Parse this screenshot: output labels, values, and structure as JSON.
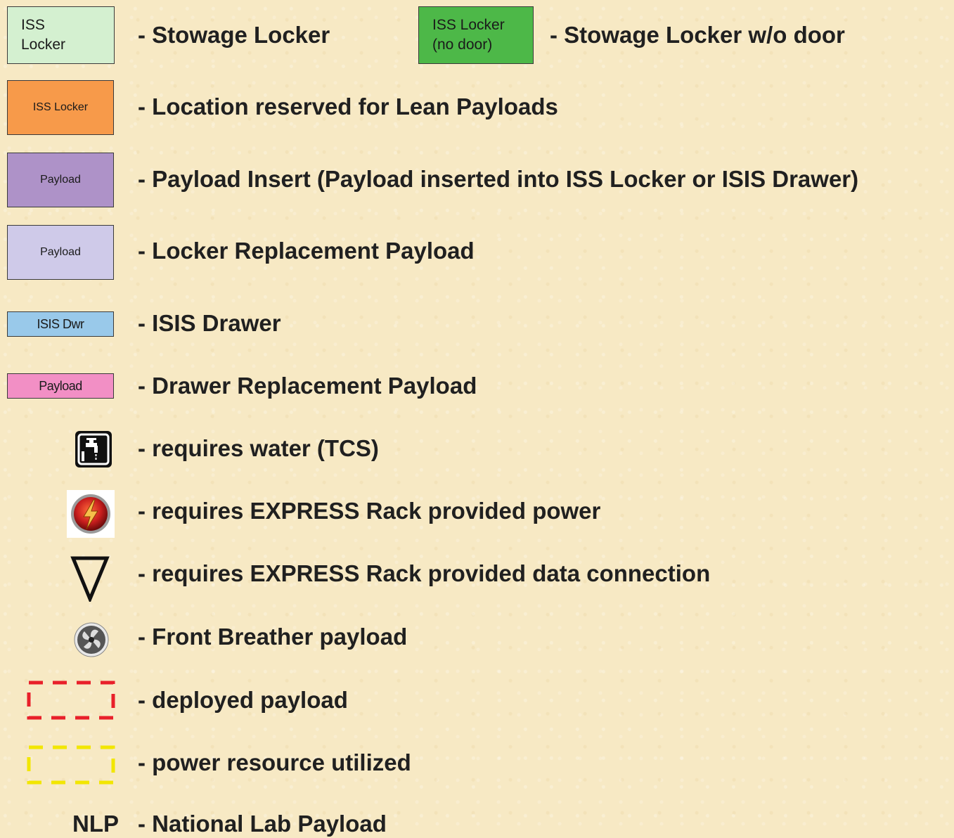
{
  "legend": {
    "stowage_locker": {
      "line1": "ISS",
      "line2": "Locker",
      "color": "#d4f0d0",
      "desc": "- Stowage Locker"
    },
    "stowage_no_door": {
      "line1": "ISS Locker",
      "line2": "(no door)",
      "color": "#4db848",
      "desc": "- Stowage Locker w/o door"
    },
    "lean_payload": {
      "label": "ISS Locker",
      "color": "#f79a4a",
      "desc": "- Location reserved for Lean Payloads"
    },
    "payload_insert": {
      "label": "Payload",
      "color": "#ae92c8",
      "desc": "- Payload Insert (Payload inserted into ISS Locker or ISIS Drawer)"
    },
    "locker_replacement": {
      "label": "Payload",
      "color": "#cfcae9",
      "desc": "- Locker Replacement Payload"
    },
    "isis_drawer": {
      "label": "ISIS Dwr",
      "color": "#99c9ea",
      "desc": "- ISIS Drawer"
    },
    "drawer_replacement": {
      "label": "Payload",
      "color": "#f28fc5",
      "desc": "- Drawer Replacement Payload"
    },
    "water": {
      "icon": "water-faucet-icon",
      "desc": "- requires water (TCS)"
    },
    "power": {
      "icon": "power-bolt-icon",
      "desc": "- requires EXPRESS Rack provided power"
    },
    "data": {
      "icon": "data-triangle-icon",
      "desc": "- requires EXPRESS Rack provided data connection"
    },
    "breather": {
      "icon": "fan-icon",
      "desc": "- Front Breather payload"
    },
    "deployed": {
      "color": "#e8202a",
      "desc": "- deployed payload"
    },
    "power_util": {
      "color": "#f2e600",
      "desc": "- power resource utilized"
    },
    "nlp": {
      "abbr": "NLP",
      "desc": "- National Lab Payload"
    }
  }
}
